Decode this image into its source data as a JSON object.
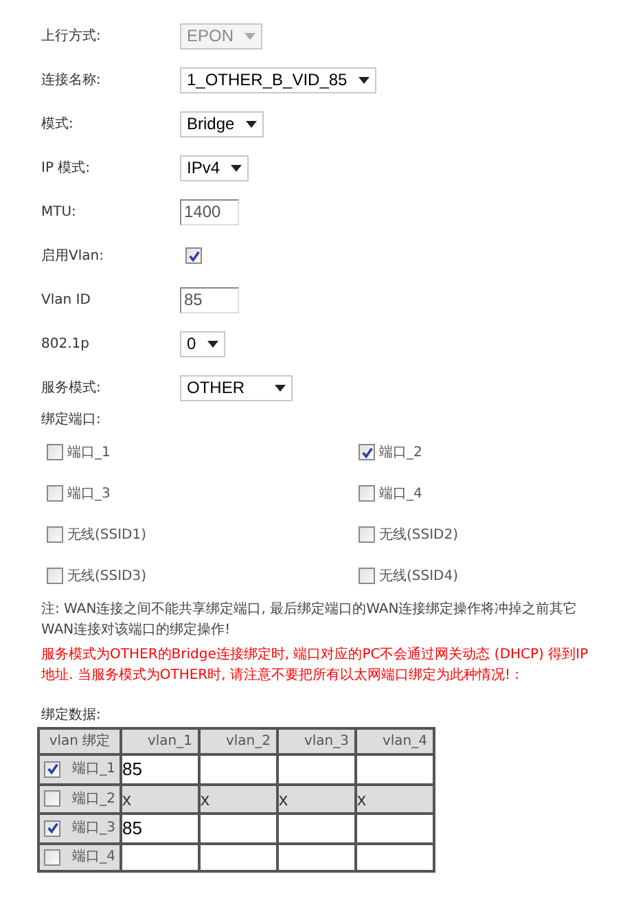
{
  "fields": [
    {
      "kind": "select",
      "label": "上行方式:",
      "value": "EPON",
      "disabled": true
    },
    {
      "kind": "select",
      "label": "连接名称:",
      "value": "1_OTHER_B_VID_85",
      "disabled": false
    },
    {
      "kind": "select",
      "label": "模式:",
      "value": "Bridge",
      "disabled": false
    },
    {
      "kind": "select",
      "label": "IP 模式:",
      "value": "IPv4",
      "disabled": false
    },
    {
      "kind": "text",
      "label": "MTU:",
      "value": "1400"
    },
    {
      "kind": "checkbox",
      "label": "启用Vlan:",
      "checked": true
    },
    {
      "kind": "text",
      "label": "Vlan ID",
      "value": "85"
    },
    {
      "kind": "select",
      "label": "802.1p",
      "value": "0",
      "disabled": false
    },
    {
      "kind": "select",
      "label": "服务模式:",
      "value": "OTHER",
      "disabled": false
    }
  ],
  "binding": {
    "label": "绑定端口:",
    "ports": [
      {
        "label": "端口_1",
        "checked": false
      },
      {
        "label": "端口_2",
        "checked": true
      },
      {
        "label": "端口_3",
        "checked": false
      },
      {
        "label": "端口_4",
        "checked": false
      },
      {
        "label": "无线(SSID1)",
        "checked": false
      },
      {
        "label": "无线(SSID2)",
        "checked": false
      },
      {
        "label": "无线(SSID3)",
        "checked": false
      },
      {
        "label": "无线(SSID4)",
        "checked": false
      }
    ]
  },
  "notes": [
    {
      "kind": "note",
      "text": "注: WAN连接之间不能共享绑定端口, 最后绑定端口的WAN连接绑定操作将冲掉之前其它WAN连接对该端口的绑定操作!"
    },
    {
      "kind": "warning",
      "text": "服务模式为OTHER的Bridge连接绑定时, 端口对应的PC不会通过网关动态 (DHCP) 得到IP地址. 当服务模式为OTHER时, 请注意不要把所有以太网端口绑定为此种情况! :"
    }
  ],
  "table": {
    "label": "绑定数据:",
    "row_header": "vlan 绑定",
    "columns": [
      "vlan_1",
      "vlan_2",
      "vlan_3",
      "vlan_4"
    ],
    "rows": [
      {
        "port": "端口_1",
        "checked": true,
        "disabled": false,
        "cells": [
          {
            "value": "85"
          },
          {},
          {},
          {}
        ]
      },
      {
        "port": "端口_2",
        "checked": false,
        "disabled": true,
        "cells": [
          {
            "value": "x"
          },
          {
            "value": "x"
          },
          {
            "value": "x"
          },
          {
            "value": "x"
          }
        ]
      },
      {
        "port": "端口_3",
        "checked": true,
        "disabled": false,
        "cells": [
          {
            "value": "85"
          },
          {},
          {},
          {}
        ]
      },
      {
        "port": "端口_4",
        "checked": false,
        "disabled": false,
        "cells": [
          {},
          {},
          {},
          {}
        ]
      }
    ]
  }
}
